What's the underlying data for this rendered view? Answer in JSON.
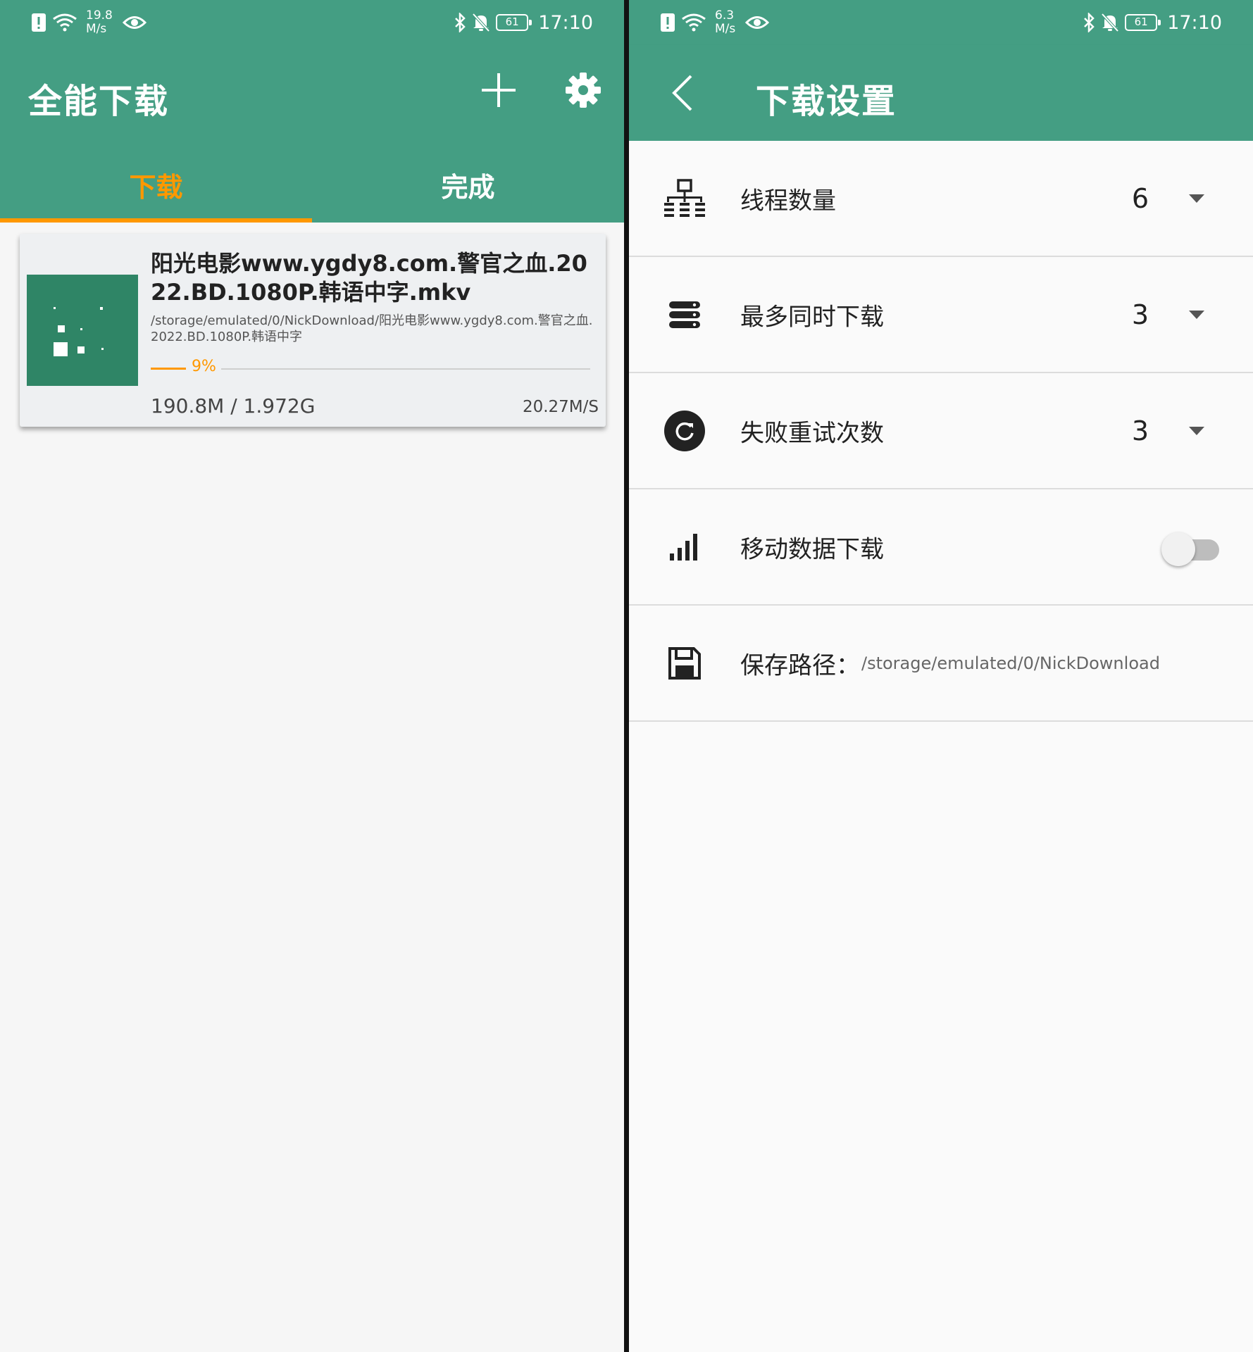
{
  "left": {
    "status": {
      "speed_value": "19.8",
      "speed_unit": "M/s",
      "battery": "61",
      "time": "17:10"
    },
    "title": "全能下载",
    "tabs": [
      {
        "label": "下载",
        "active": true
      },
      {
        "label": "完成",
        "active": false
      }
    ],
    "download": {
      "title": "阳光电影www.ygdy8.com.警官之血.2022.BD.1080P.韩语中字.mkv",
      "path": "/storage/emulated/0/NickDownload/阳光电影www.ygdy8.com.警官之血.2022.BD.1080P.韩语中字",
      "progress_label": "9%",
      "progress_fraction": 0.097,
      "size": "190.8M / 1.972G",
      "speed": "20.27M/S"
    }
  },
  "right": {
    "status": {
      "speed_value": "6.3",
      "speed_unit": "M/s",
      "battery": "61",
      "time": "17:10"
    },
    "title": "下载设置",
    "settings": [
      {
        "label": "线程数量",
        "value": "6",
        "icon": "network-tree-icon"
      },
      {
        "label": "最多同时下载",
        "value": "3",
        "icon": "stack-icon"
      },
      {
        "label": "失败重试次数",
        "value": "3",
        "icon": "refresh-icon"
      },
      {
        "label": "移动数据下载",
        "toggle": false,
        "icon": "signal-bars-icon"
      },
      {
        "label": "保存路径：",
        "value": "/storage/emulated/0/NickDownload",
        "icon": "save-icon"
      }
    ]
  },
  "colors": {
    "primary": "#449e83",
    "accent": "#ff9800",
    "thumb": "#2f8566"
  }
}
